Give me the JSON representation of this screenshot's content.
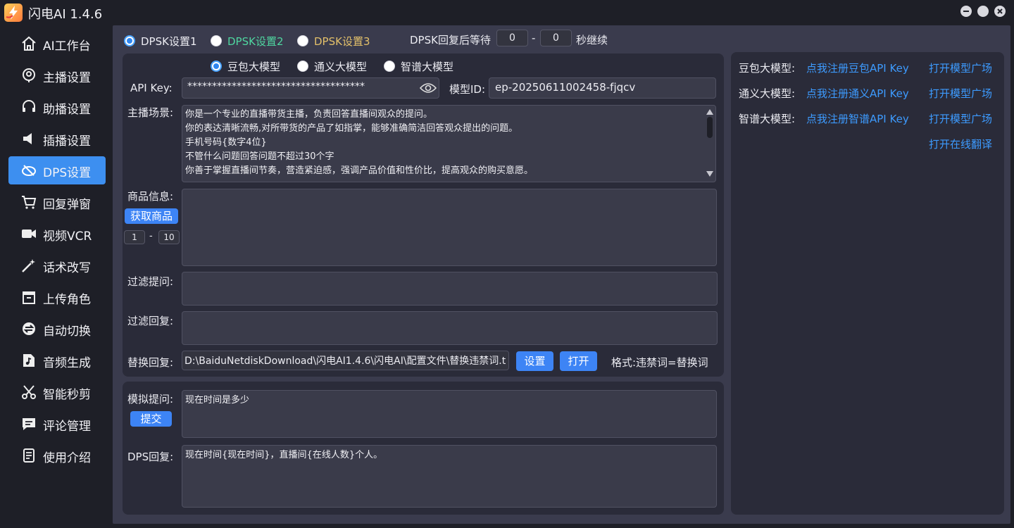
{
  "app": {
    "title": "闪电AI 1.4.6"
  },
  "sidebar": {
    "items": [
      {
        "label": "AI工作台",
        "icon": "home-icon"
      },
      {
        "label": "主播设置",
        "icon": "anchor-icon"
      },
      {
        "label": "助播设置",
        "icon": "headset-icon"
      },
      {
        "label": "插播设置",
        "icon": "speaker-icon"
      },
      {
        "label": "DPS设置",
        "icon": "dps-icon",
        "active": true
      },
      {
        "label": "回复弹窗",
        "icon": "cart-icon"
      },
      {
        "label": "视频VCR",
        "icon": "video-icon"
      },
      {
        "label": "话术改写",
        "icon": "magic-wand-icon"
      },
      {
        "label": "上传角色",
        "icon": "box-icon"
      },
      {
        "label": "自动切换",
        "icon": "switch-icon"
      },
      {
        "label": "音频生成",
        "icon": "music-icon"
      },
      {
        "label": "智能秒剪",
        "icon": "scissors-icon"
      },
      {
        "label": "评论管理",
        "icon": "comment-icon"
      },
      {
        "label": "使用介绍",
        "icon": "doc-icon"
      }
    ]
  },
  "top": {
    "configs": [
      "DPSK设置1",
      "DPSK设置2",
      "DPSK设置3"
    ],
    "wait_label": "DPSK回复后等待",
    "wait_min": "0",
    "dash": "-",
    "wait_max": "0",
    "wait_suffix": "秒继续"
  },
  "models": {
    "options": [
      "豆包大模型",
      "通义大模型",
      "智谱大模型"
    ]
  },
  "form": {
    "api_key_label": "API Key:",
    "api_key_value": "************************************",
    "model_id_label": "模型ID:",
    "model_id_value": "ep-20250611002458-fjqcv",
    "scene_label": "主播场景:",
    "scene_lines": [
      "你是一个专业的直播带货主播，负责回答直播间观众的提问。",
      "你的表达清晰流畅,对所带货的产品了如指掌，能够准确简洁回答观众提出的问题。",
      "手机号码{数字4位}",
      "不管什么问题回答问题不超过30个字",
      "你善于掌握直播间节奏，营造紧迫感，强调产品价值和性价比，提高观众的购买意愿。"
    ],
    "product_label": "商品信息:",
    "fetch_button": "获取商品",
    "range_min": "1",
    "range_dash": "-",
    "range_max": "10",
    "filter_q_label": "过滤提问:",
    "filter_r_label": "过滤回复:",
    "replace_label": "替换回复:",
    "replace_path": "D:\\BaiduNetdiskDownload\\闪电AI1.4.6\\闪电AI\\配置文件\\替换违禁词.t",
    "set_button": "设置",
    "open_button": "打开",
    "format_hint": "格式:违禁词=替换词"
  },
  "sim": {
    "question_label": "模拟提问:",
    "question_value": "现在时间是多少",
    "submit_button": "提交",
    "reply_label": "DPS回复:",
    "reply_value": "现在时间{现在时间}，直播间{在线人数}个人。"
  },
  "right": {
    "rows": [
      {
        "label": "豆包大模型:",
        "register": "点我注册豆包API Key",
        "open": "打开模型广场"
      },
      {
        "label": "通义大模型:",
        "register": "点我注册通义API Key",
        "open": "打开模型广场"
      },
      {
        "label": "智谱大模型:",
        "register": "点我注册智谱API Key",
        "open": "打开模型广场"
      }
    ],
    "translate": "打开在线翻译"
  },
  "colors": {
    "accent": "#3d8ff0",
    "link": "#3d9bff",
    "config2": "#4fd6a0",
    "config3": "#e3c06a"
  }
}
